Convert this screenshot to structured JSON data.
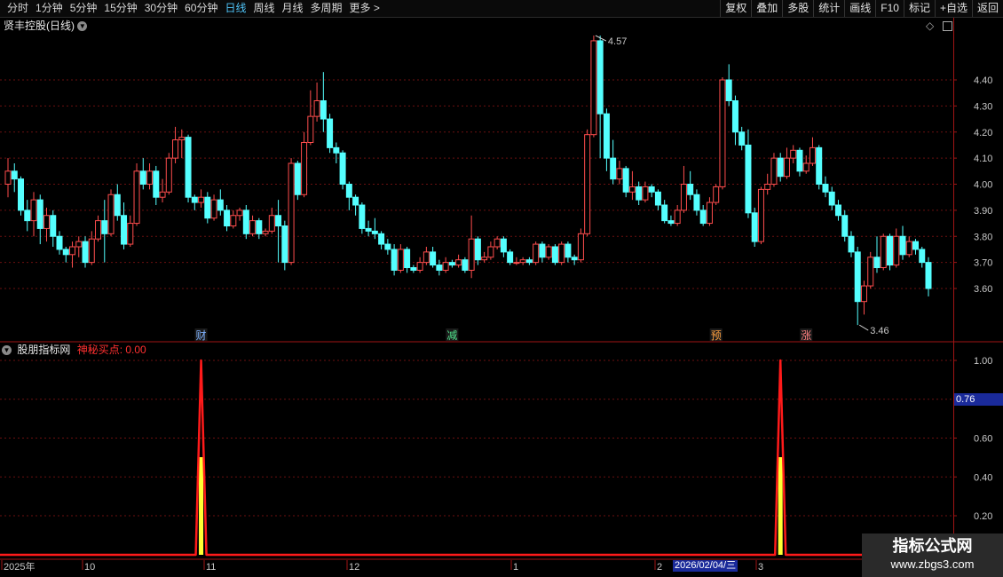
{
  "toolbar": {
    "periods": [
      "分时",
      "1分钟",
      "5分钟",
      "15分钟",
      "30分钟",
      "60分钟",
      "日线",
      "周线",
      "月线",
      "多周期",
      "更多 >"
    ],
    "active_period": "日线",
    "right_buttons": [
      "复权",
      "叠加",
      "多股",
      "统计",
      "画线",
      "F10",
      "标记",
      "+自选",
      "返回"
    ]
  },
  "price_panel": {
    "title": "贤丰控股(日线)",
    "high_label": "4.57",
    "low_label": "3.46",
    "markers": [
      {
        "text": "财",
        "color": "#7fb2ff"
      },
      {
        "text": "减",
        "color": "#4fe08a"
      },
      {
        "text": "预",
        "color": "#ffa040"
      },
      {
        "text": "涨",
        "color": "#ff8080"
      }
    ],
    "y_ticks": [
      "4.40",
      "4.30",
      "4.20",
      "4.10",
      "4.00",
      "3.90",
      "3.80",
      "3.70",
      "3.60"
    ]
  },
  "indicator_panel": {
    "title": "股朋指标网",
    "series_label": "神秘买点: 0.00",
    "y_ticks": [
      "1.00",
      "0.60",
      "0.40",
      "0.20"
    ],
    "current_value": "0.76"
  },
  "x_axis": {
    "labels": [
      "2025年",
      "10",
      "11",
      "12",
      "1",
      "2",
      "3"
    ],
    "cursor_date": "2026/02/04/三"
  },
  "watermark": {
    "line1": "指标公式网",
    "line2": "www.zbgs3.com"
  },
  "colors": {
    "up": "#ff4d4d",
    "down": "#54ffff",
    "grid": "#6b1010",
    "signal": "#ff1a1a",
    "signal_fill": "#ffff33"
  },
  "chart_data": {
    "type": "candlestick",
    "ylim": [
      3.4,
      4.6
    ],
    "candles": [
      [
        4.0,
        4.05,
        3.95,
        4.1
      ],
      [
        4.05,
        4.02,
        3.97,
        4.08
      ],
      [
        4.02,
        3.9,
        3.88,
        4.03
      ],
      [
        3.9,
        3.86,
        3.82,
        3.94
      ],
      [
        3.86,
        3.94,
        3.8,
        3.97
      ],
      [
        3.94,
        3.83,
        3.77,
        3.96
      ],
      [
        3.83,
        3.88,
        3.78,
        3.91
      ],
      [
        3.88,
        3.8,
        3.76,
        3.9
      ],
      [
        3.8,
        3.75,
        3.73,
        3.82
      ],
      [
        3.75,
        3.73,
        3.7,
        3.76
      ],
      [
        3.73,
        3.76,
        3.68,
        3.78
      ],
      [
        3.76,
        3.78,
        3.72,
        3.8
      ],
      [
        3.78,
        3.7,
        3.68,
        3.8
      ],
      [
        3.7,
        3.79,
        3.69,
        3.82
      ],
      [
        3.79,
        3.86,
        3.78,
        3.88
      ],
      [
        3.86,
        3.81,
        3.7,
        3.94
      ],
      [
        3.81,
        3.96,
        3.8,
        3.98
      ],
      [
        3.96,
        3.88,
        3.86,
        4.0
      ],
      [
        3.88,
        3.77,
        3.75,
        3.93
      ],
      [
        3.77,
        3.85,
        3.76,
        3.88
      ],
      [
        3.85,
        4.05,
        3.84,
        4.08
      ],
      [
        4.05,
        4.0,
        3.98,
        4.1
      ],
      [
        4.0,
        4.05,
        3.98,
        4.08
      ],
      [
        4.05,
        3.95,
        3.92,
        4.07
      ],
      [
        3.95,
        3.97,
        3.93,
        4.02
      ],
      [
        3.97,
        4.1,
        3.96,
        4.12
      ],
      [
        4.1,
        4.17,
        4.08,
        4.22
      ],
      [
        4.17,
        4.18,
        4.1,
        4.21
      ],
      [
        4.18,
        3.95,
        3.93,
        4.19
      ],
      [
        3.95,
        3.93,
        3.9,
        3.96
      ],
      [
        3.93,
        3.95,
        3.91,
        3.98
      ],
      [
        3.95,
        3.87,
        3.85,
        3.97
      ],
      [
        3.87,
        3.94,
        3.86,
        3.96
      ],
      [
        3.94,
        3.9,
        3.88,
        3.98
      ],
      [
        3.9,
        3.84,
        3.82,
        3.92
      ],
      [
        3.84,
        3.88,
        3.83,
        3.9
      ],
      [
        3.88,
        3.9,
        3.86,
        3.91
      ],
      [
        3.9,
        3.81,
        3.79,
        3.92
      ],
      [
        3.81,
        3.86,
        3.8,
        3.88
      ],
      [
        3.86,
        3.81,
        3.79,
        3.87
      ],
      [
        3.81,
        3.82,
        3.8,
        3.83
      ],
      [
        3.82,
        3.88,
        3.81,
        3.91
      ],
      [
        3.88,
        3.84,
        3.7,
        3.94
      ],
      [
        3.84,
        3.7,
        3.67,
        3.86
      ],
      [
        3.7,
        4.08,
        3.69,
        4.1
      ],
      [
        4.08,
        3.96,
        3.94,
        4.09
      ],
      [
        3.96,
        4.16,
        3.95,
        4.2
      ],
      [
        4.16,
        4.26,
        4.15,
        4.36
      ],
      [
        4.26,
        4.32,
        4.24,
        4.39
      ],
      [
        4.32,
        4.25,
        4.2,
        4.43
      ],
      [
        4.25,
        4.14,
        4.12,
        4.27
      ],
      [
        4.14,
        4.12,
        4.08,
        4.16
      ],
      [
        4.12,
        4.0,
        3.98,
        4.13
      ],
      [
        4.0,
        3.95,
        3.9,
        4.01
      ],
      [
        3.95,
        3.92,
        3.88,
        3.96
      ],
      [
        3.92,
        3.83,
        3.81,
        3.93
      ],
      [
        3.83,
        3.82,
        3.8,
        3.86
      ],
      [
        3.82,
        3.81,
        3.79,
        3.87
      ],
      [
        3.81,
        3.77,
        3.75,
        3.82
      ],
      [
        3.77,
        3.75,
        3.73,
        3.79
      ],
      [
        3.75,
        3.67,
        3.65,
        3.77
      ],
      [
        3.67,
        3.75,
        3.66,
        3.77
      ],
      [
        3.75,
        3.68,
        3.66,
        3.76
      ],
      [
        3.68,
        3.67,
        3.66,
        3.69
      ],
      [
        3.67,
        3.7,
        3.66,
        3.72
      ],
      [
        3.7,
        3.74,
        3.69,
        3.76
      ],
      [
        3.74,
        3.69,
        3.68,
        3.76
      ],
      [
        3.69,
        3.67,
        3.65,
        3.71
      ],
      [
        3.67,
        3.7,
        3.66,
        3.72
      ],
      [
        3.7,
        3.69,
        3.68,
        3.71
      ],
      [
        3.69,
        3.71,
        3.68,
        3.73
      ],
      [
        3.71,
        3.67,
        3.66,
        3.72
      ],
      [
        3.67,
        3.79,
        3.64,
        3.88
      ],
      [
        3.79,
        3.71,
        3.69,
        3.8
      ],
      [
        3.71,
        3.72,
        3.7,
        3.74
      ],
      [
        3.72,
        3.76,
        3.71,
        3.78
      ],
      [
        3.76,
        3.79,
        3.75,
        3.8
      ],
      [
        3.79,
        3.74,
        3.72,
        3.8
      ],
      [
        3.74,
        3.7,
        3.69,
        3.75
      ],
      [
        3.7,
        3.7,
        3.69,
        3.72
      ],
      [
        3.7,
        3.71,
        3.69,
        3.72
      ],
      [
        3.71,
        3.7,
        3.69,
        3.72
      ],
      [
        3.7,
        3.77,
        3.69,
        3.78
      ],
      [
        3.77,
        3.72,
        3.7,
        3.78
      ],
      [
        3.72,
        3.76,
        3.71,
        3.77
      ],
      [
        3.76,
        3.7,
        3.69,
        3.77
      ],
      [
        3.7,
        3.77,
        3.69,
        3.78
      ],
      [
        3.77,
        3.72,
        3.7,
        3.78
      ],
      [
        3.72,
        3.71,
        3.69,
        3.73
      ],
      [
        3.71,
        3.81,
        3.7,
        3.83
      ],
      [
        3.81,
        4.19,
        3.8,
        4.21
      ],
      [
        4.19,
        4.55,
        4.18,
        4.57
      ],
      [
        4.55,
        4.27,
        4.1,
        4.57
      ],
      [
        4.27,
        4.1,
        4.05,
        4.29
      ],
      [
        4.1,
        4.02,
        4.0,
        4.17
      ],
      [
        4.02,
        4.06,
        4.0,
        4.09
      ],
      [
        4.06,
        3.97,
        3.95,
        4.07
      ],
      [
        3.97,
        3.99,
        3.94,
        4.05
      ],
      [
        3.99,
        3.94,
        3.92,
        4.01
      ],
      [
        3.94,
        3.99,
        3.93,
        4.01
      ],
      [
        3.99,
        3.97,
        3.95,
        4.0
      ],
      [
        3.97,
        3.92,
        3.9,
        3.98
      ],
      [
        3.92,
        3.86,
        3.85,
        3.94
      ],
      [
        3.86,
        3.85,
        3.84,
        3.88
      ],
      [
        3.85,
        3.9,
        3.84,
        3.92
      ],
      [
        3.9,
        4.0,
        3.89,
        4.07
      ],
      [
        4.0,
        3.96,
        3.94,
        4.05
      ],
      [
        3.96,
        3.9,
        3.88,
        3.98
      ],
      [
        3.9,
        3.85,
        3.84,
        3.92
      ],
      [
        3.85,
        3.93,
        3.84,
        3.95
      ],
      [
        3.93,
        3.99,
        3.92,
        4.0
      ],
      [
        3.99,
        4.4,
        3.98,
        4.41
      ],
      [
        4.4,
        4.32,
        4.3,
        4.46
      ],
      [
        4.32,
        4.2,
        4.15,
        4.34
      ],
      [
        4.2,
        4.15,
        4.13,
        4.22
      ],
      [
        4.15,
        3.89,
        3.87,
        4.21
      ],
      [
        3.89,
        3.78,
        3.76,
        3.91
      ],
      [
        3.78,
        3.98,
        3.77,
        3.99
      ],
      [
        3.98,
        4.0,
        3.96,
        4.04
      ],
      [
        4.0,
        4.1,
        3.99,
        4.12
      ],
      [
        4.1,
        4.03,
        4.01,
        4.12
      ],
      [
        4.03,
        4.1,
        4.02,
        4.14
      ],
      [
        4.1,
        4.13,
        4.08,
        4.15
      ],
      [
        4.13,
        4.05,
        4.03,
        4.14
      ],
      [
        4.05,
        4.08,
        4.04,
        4.11
      ],
      [
        4.08,
        4.14,
        4.07,
        4.18
      ],
      [
        4.14,
        4.0,
        3.98,
        4.15
      ],
      [
        4.0,
        3.97,
        3.95,
        4.03
      ],
      [
        3.97,
        3.92,
        3.9,
        3.99
      ],
      [
        3.92,
        3.88,
        3.86,
        3.94
      ],
      [
        3.88,
        3.8,
        3.78,
        3.9
      ],
      [
        3.8,
        3.74,
        3.72,
        3.82
      ],
      [
        3.74,
        3.55,
        3.46,
        3.76
      ],
      [
        3.55,
        3.61,
        3.5,
        3.63
      ],
      [
        3.61,
        3.72,
        3.6,
        3.74
      ],
      [
        3.72,
        3.68,
        3.66,
        3.8
      ],
      [
        3.68,
        3.8,
        3.67,
        3.81
      ],
      [
        3.8,
        3.69,
        3.67,
        3.81
      ],
      [
        3.69,
        3.8,
        3.68,
        3.83
      ],
      [
        3.8,
        3.73,
        3.71,
        3.84
      ],
      [
        3.73,
        3.78,
        3.72,
        3.8
      ],
      [
        3.78,
        3.75,
        3.73,
        3.79
      ],
      [
        3.75,
        3.7,
        3.68,
        3.76
      ],
      [
        3.7,
        3.6,
        3.57,
        3.72
      ]
    ],
    "signal": {
      "ylim": [
        0,
        1.1
      ],
      "pulses": [
        {
          "index": 30,
          "value": 1.0
        },
        {
          "index": 120,
          "value": 1.0
        }
      ]
    }
  }
}
